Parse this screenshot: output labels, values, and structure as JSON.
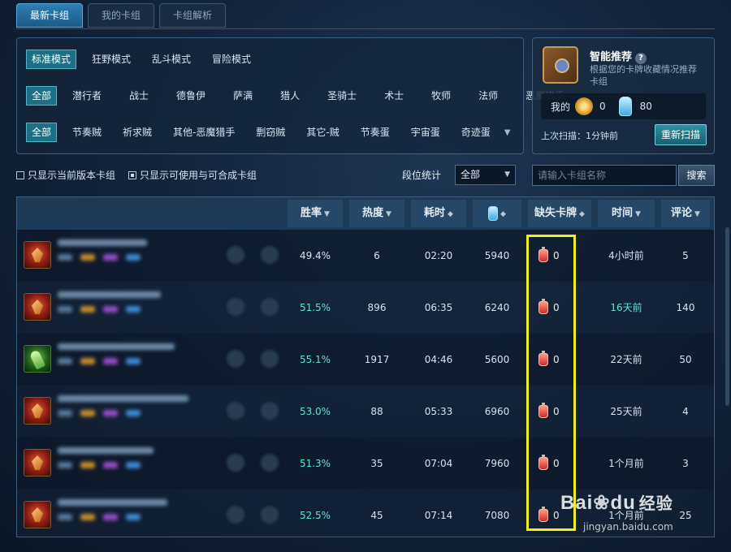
{
  "top_tabs": [
    {
      "label": "最新卡组"
    },
    {
      "label": "我的卡组"
    },
    {
      "label": "卡组解析"
    }
  ],
  "modes": [
    "标准模式",
    "狂野模式",
    "乱斗模式",
    "冒险模式"
  ],
  "classes": [
    "全部",
    "潜行者",
    "战士",
    "德鲁伊",
    "萨满",
    "猎人",
    "圣骑士",
    "术士",
    "牧师",
    "法师",
    "恶魔猎手"
  ],
  "archetypes": [
    "全部",
    "节奏贼",
    "祈求贼",
    "其他-恶魔猎手",
    "剽窃贼",
    "其它-贼",
    "节奏蛋",
    "宇宙蛋",
    "奇迹蛋"
  ],
  "smart": {
    "title": "智能推荐",
    "help": "?",
    "desc": "根据您的卡牌收藏情况推荐卡组",
    "mine_label": "我的",
    "gold": "0",
    "dust": "80",
    "last_scan": "上次扫描：1分钟前",
    "rescan": "重新扫描"
  },
  "options": {
    "current_version": "只显示当前版本卡组",
    "usable_only": "只显示可使用与可合成卡组",
    "rank_label": "段位统计",
    "rank_value": "全部",
    "search_placeholder": "请输入卡组名称",
    "search_btn": "搜索"
  },
  "columns": {
    "winrate": "胜率",
    "heat": "热度",
    "time": "耗时",
    "missing": "缺失卡牌",
    "posted": "时间",
    "comments": "评论"
  },
  "rows": [
    {
      "winrate": "49.4%",
      "heat": "6",
      "time": "02:20",
      "dust": "5940",
      "missing": "0",
      "posted": "4小时前",
      "comments": "5"
    },
    {
      "winrate": "51.5%",
      "heat": "896",
      "time": "06:35",
      "dust": "6240",
      "missing": "0",
      "posted": "16天前",
      "comments": "140"
    },
    {
      "winrate": "55.1%",
      "heat": "1917",
      "time": "04:46",
      "dust": "5600",
      "missing": "0",
      "posted": "22天前",
      "comments": "50"
    },
    {
      "winrate": "53.0%",
      "heat": "88",
      "time": "05:33",
      "dust": "6960",
      "missing": "0",
      "posted": "25天前",
      "comments": "4"
    },
    {
      "winrate": "51.3%",
      "heat": "35",
      "time": "07:04",
      "dust": "7960",
      "missing": "0",
      "posted": "1个月前",
      "comments": "3"
    },
    {
      "winrate": "52.5%",
      "heat": "45",
      "time": "07:14",
      "dust": "7080",
      "missing": "0",
      "posted": "1个月前",
      "comments": "25"
    }
  ],
  "watermark": {
    "brand": "Bai",
    "brand2": "du",
    "cn": "经验",
    "url": "jingyan.baidu.com"
  },
  "colors": {
    "accent": "#1d6f86",
    "highlight": "#f5ec1c",
    "teal_text": "#5fe0d8"
  }
}
